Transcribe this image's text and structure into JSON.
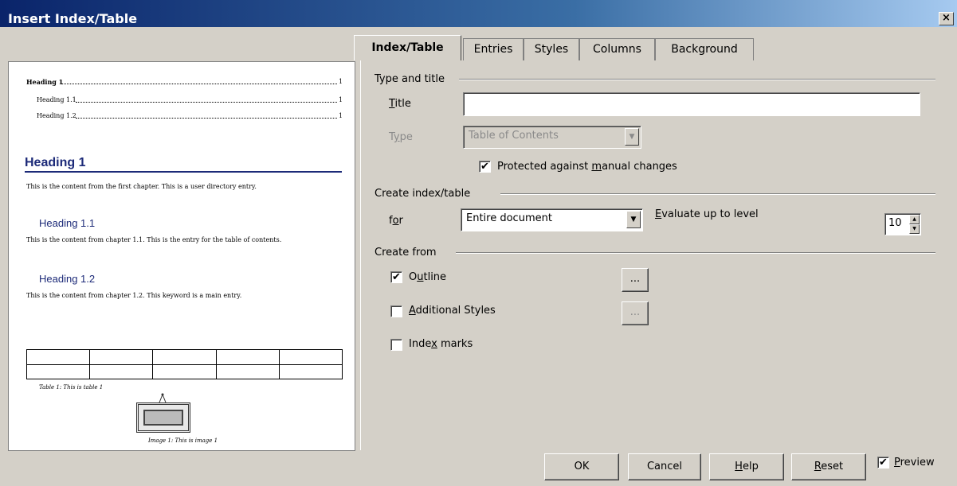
{
  "window": {
    "title": "Insert Index/Table",
    "close_label": "×"
  },
  "preview": {
    "toc": [
      {
        "text": "Heading 1",
        "page": "1"
      },
      {
        "text": "Heading 1.1",
        "page": "1"
      },
      {
        "text": "Heading 1.2",
        "page": "1"
      }
    ],
    "heading1": "Heading 1",
    "text1": "This is the content from the first chapter. This is a user directory entry.",
    "heading11": "Heading 1.1",
    "text11": "This is the content from chapter 1.1. This is the entry for the table of contents.",
    "heading12": "Heading 1.2",
    "text12": "This is the content from chapter 1.2. This keyword is a main entry.",
    "table_caption": "Table 1: This is table 1",
    "image_caption": "Image 1: This is image 1"
  },
  "tabs": [
    {
      "label": "Index/Table",
      "active": true
    },
    {
      "label": "Entries",
      "active": false
    },
    {
      "label": "Styles",
      "active": false
    },
    {
      "label": "Columns",
      "active": false
    },
    {
      "label": "Background",
      "active": false
    }
  ],
  "type_and_title": {
    "section_label": "Type and title",
    "title_label": "Title",
    "title_value": "",
    "type_label": "Type",
    "type_value": "Table of Contents",
    "protected_label": "Protected against manual changes",
    "protected_checked": true
  },
  "create_index": {
    "section_label": "Create index/table",
    "for_label": "for",
    "for_value": "Entire document",
    "evaluate_label": "Evaluate up to level",
    "level_value": "10"
  },
  "create_from": {
    "section_label": "Create from",
    "outline_label": "Outline",
    "outline_checked": true,
    "outline_btn": "...",
    "additional_label": "Additional Styles",
    "additional_checked": false,
    "additional_btn": "...",
    "index_marks_label": "Index marks",
    "index_marks_checked": false
  },
  "buttons": {
    "ok": "OK",
    "cancel": "Cancel",
    "help": "Help",
    "reset": "Reset"
  },
  "preview_toggle": {
    "label": "Preview",
    "checked": true
  },
  "check_mark": "✔"
}
